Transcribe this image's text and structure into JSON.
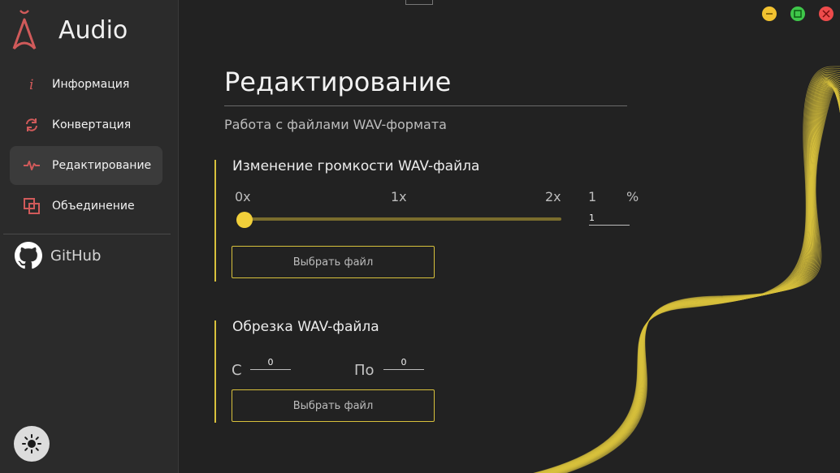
{
  "app": {
    "title": "Audio"
  },
  "sidebar": {
    "items": [
      {
        "label": "Информация",
        "icon": "info-icon"
      },
      {
        "label": "Конвертация",
        "icon": "convert-icon"
      },
      {
        "label": "Редактирование",
        "icon": "waveform-icon",
        "active": true
      },
      {
        "label": "Объединение",
        "icon": "merge-icon"
      }
    ],
    "github_label": "GitHub",
    "theme_toggle_icon": "sun-icon"
  },
  "window_controls": [
    "minimize-button",
    "maximize-button",
    "close-button"
  ],
  "main": {
    "title": "Редактирование",
    "subtitle": "Работа с файлами WAV-формата",
    "volume": {
      "title": "Изменение громкости WAV-файла",
      "ticks": [
        "0x",
        "1x",
        "2x"
      ],
      "percent_value": "1",
      "percent_sign": "%",
      "input_value": "1",
      "slider_fraction": 0,
      "button_label": "Выбрать файл"
    },
    "trim": {
      "title": "Обрезка WAV-файла",
      "from_label": "С",
      "from_value": "0",
      "to_label": "По",
      "to_value": "0",
      "button_label": "Выбрать файл"
    }
  },
  "colors": {
    "accent": "#d8c13c",
    "slider_thumb": "#f1cf3a",
    "icon_red": "#d05a5a",
    "minimize": "#f2c230",
    "maximize": "#3fc74a",
    "close": "#ee4b4b"
  }
}
